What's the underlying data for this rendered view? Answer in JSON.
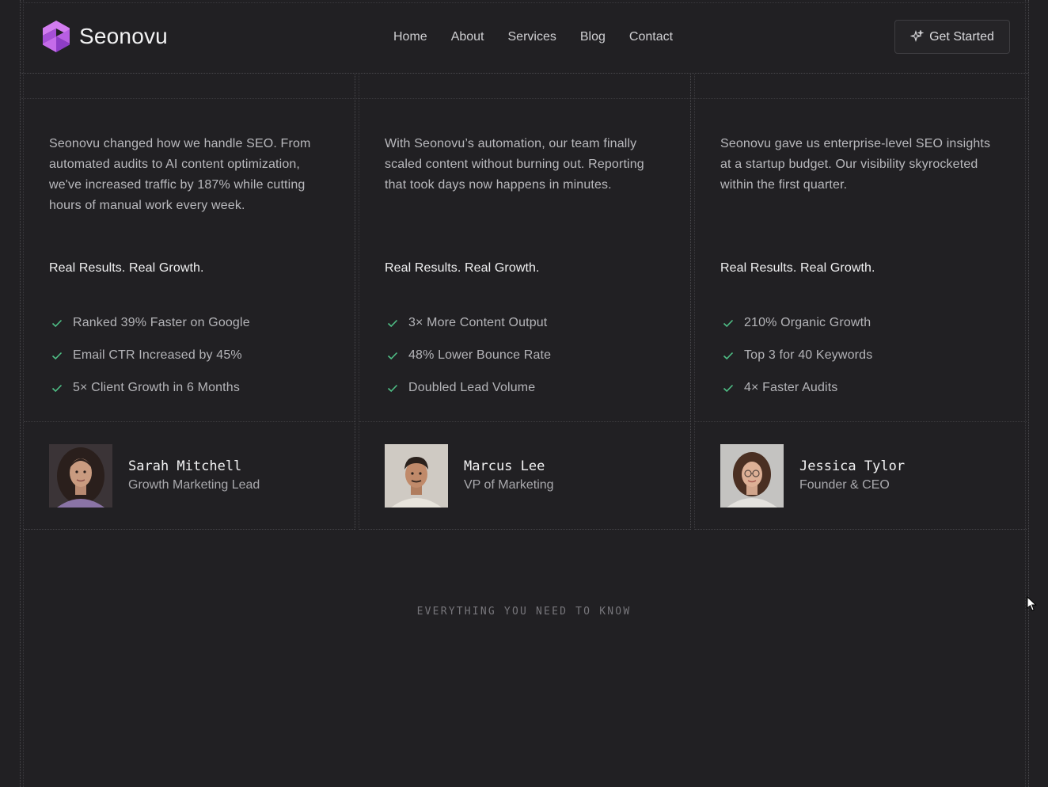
{
  "brand": {
    "name": "Seonovu",
    "accent": "#c06be8"
  },
  "nav": {
    "items": [
      {
        "label": "Home"
      },
      {
        "label": "About"
      },
      {
        "label": "Services"
      },
      {
        "label": "Blog"
      },
      {
        "label": "Contact"
      }
    ],
    "cta_label": "Get Started",
    "cta_icon": "sparkle-icon"
  },
  "testimonials": [
    {
      "quote": "Seonovu changed how we handle SEO. From automated audits to AI content optimization, we've increased traffic by 187% while cutting hours of manual work every week.",
      "results_title": "Real Results. Real Growth.",
      "results": [
        "Ranked 39% Faster on Google",
        "Email CTR Increased by 45%",
        "5× Client Growth in 6 Months"
      ],
      "name": "Sarah Mitchell",
      "role": "Growth Marketing Lead"
    },
    {
      "quote": "With Seonovu’s automation, our team finally scaled content without burning out. Reporting that took days now happens in minutes.",
      "results_title": "Real Results. Real Growth.",
      "results": [
        "3× More Content Output",
        "48% Lower Bounce Rate",
        "Doubled Lead Volume"
      ],
      "name": "Marcus Lee",
      "role": "VP of Marketing"
    },
    {
      "quote": "Seonovu gave us enterprise-level SEO insights at a startup budget. Our visibility skyrocketed within the first quarter.",
      "results_title": "Real Results. Real Growth.",
      "results": [
        "210% Organic Growth",
        "Top 3 for 40 Keywords",
        "4× Faster Audits"
      ],
      "name": "Jessica Tylor",
      "role": "Founder & CEO"
    }
  ],
  "check_color": "#4fbf86",
  "faq": {
    "eyebrow": "EVERYTHING YOU NEED TO KNOW"
  }
}
